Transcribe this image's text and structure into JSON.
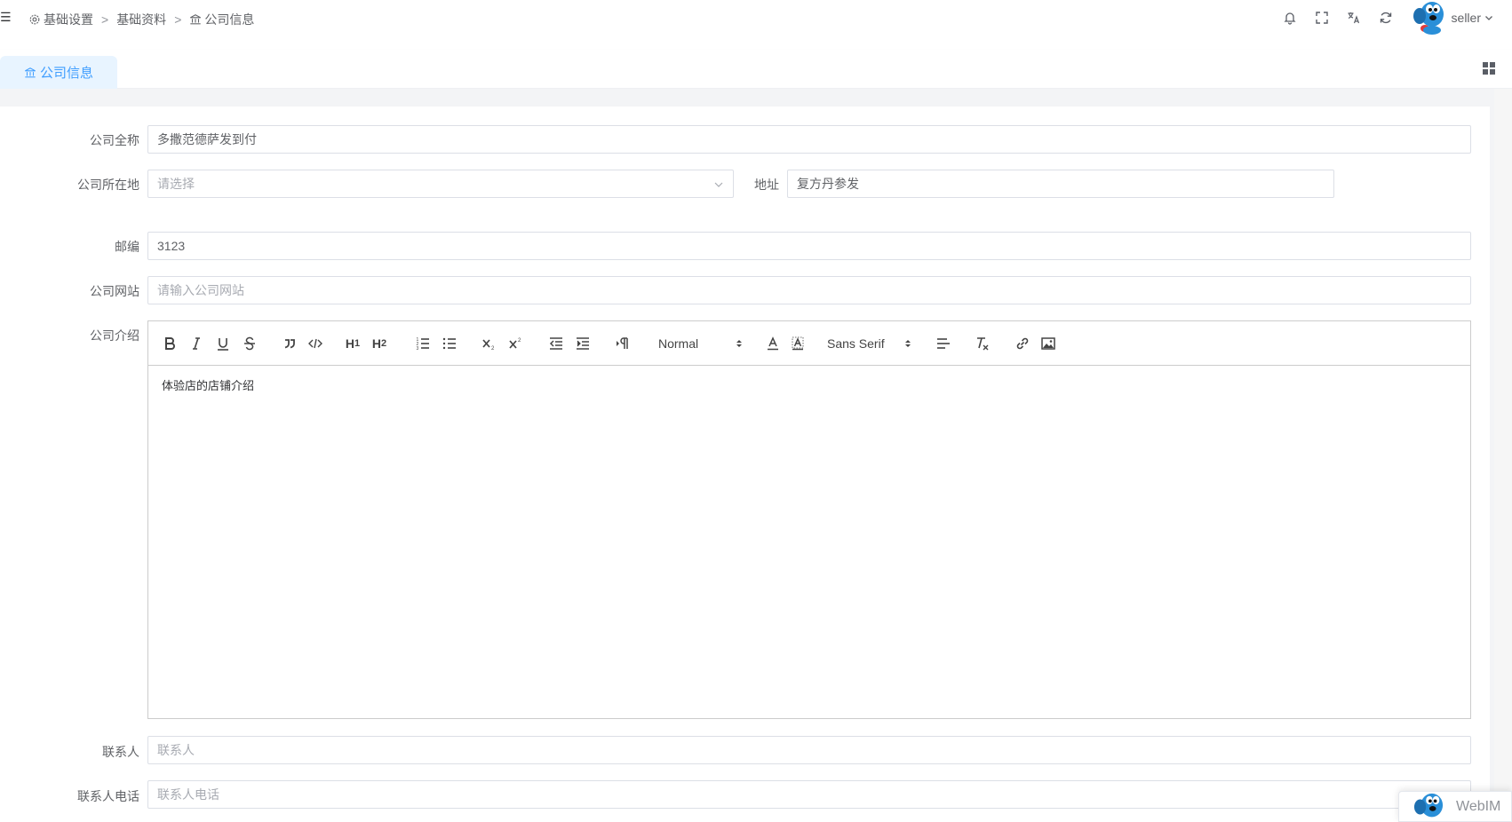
{
  "header": {
    "hamburger": "☰",
    "breadcrumb": [
      "基础设置",
      "基础资料",
      "公司信息"
    ],
    "separator": ">",
    "username": "seller"
  },
  "tabs": [
    {
      "label": "公司信息",
      "active": true
    }
  ],
  "form": {
    "company_name": {
      "label": "公司全称",
      "value": "多撒范德萨发到付"
    },
    "company_location": {
      "label": "公司所在地",
      "placeholder": "请选择"
    },
    "address": {
      "label": "地址",
      "value": "复方丹参发"
    },
    "postcode": {
      "label": "邮编",
      "value": "3123"
    },
    "website": {
      "label": "公司网站",
      "placeholder": "请输入公司网站"
    },
    "intro": {
      "label": "公司介绍",
      "content": "体验店的店铺介绍"
    },
    "contact": {
      "label": "联系人",
      "placeholder": "联系人"
    },
    "contact_phone": {
      "label": "联系人电话",
      "placeholder": "联系人电话"
    }
  },
  "editor_toolbar": {
    "header_select": "Normal",
    "font_select": "Sans Serif",
    "h1": "H",
    "h2": "H"
  },
  "webim": {
    "label": "WebIM"
  },
  "colors": {
    "accent": "#409eff",
    "tab_bg": "#e8f4ff",
    "border": "#dcdfe6",
    "placeholder": "#a8abb2"
  }
}
